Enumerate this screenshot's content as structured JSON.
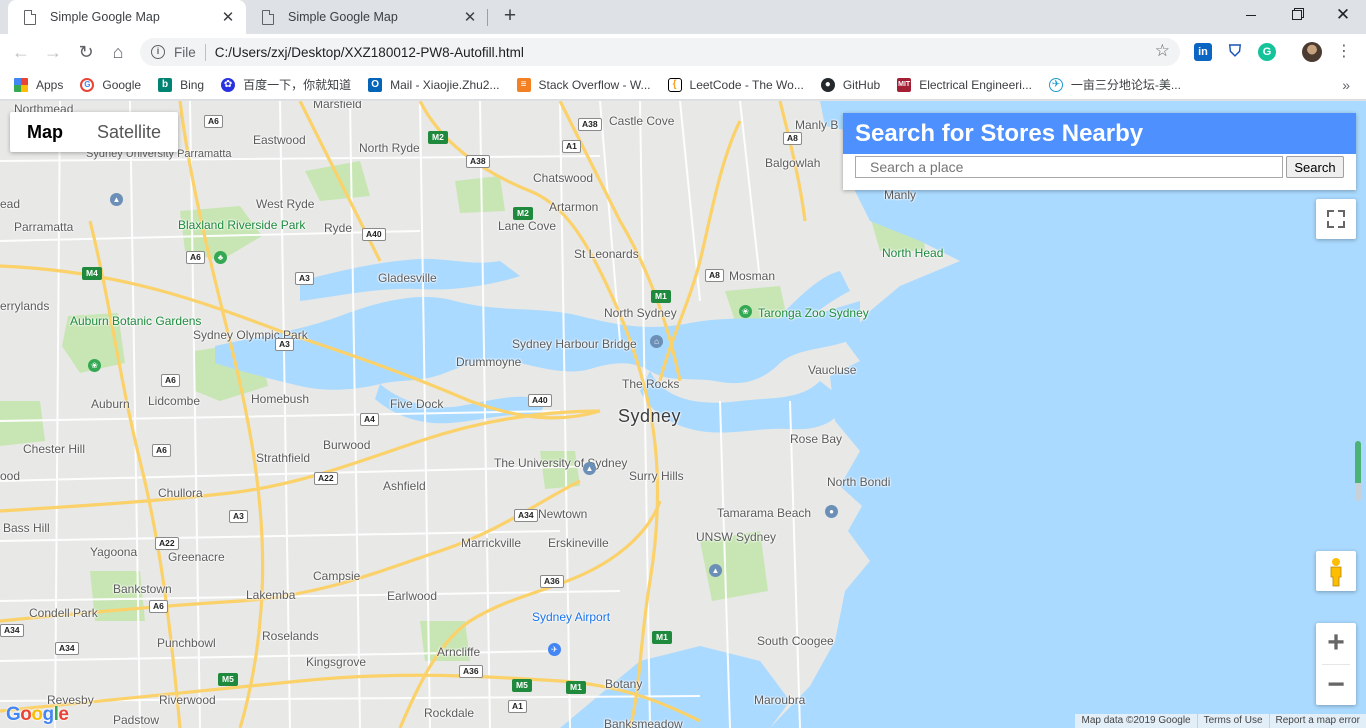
{
  "browser": {
    "tabs": [
      {
        "title": "Simple Google Map",
        "active": true
      },
      {
        "title": "Simple Google Map",
        "active": false
      }
    ],
    "new_tab_icon": "plus-icon",
    "window_controls": [
      "minimize-icon",
      "restore-icon",
      "close-icon"
    ],
    "omnibox": {
      "scheme": "File",
      "url": "C:/Users/zxj/Desktop/XXZ180012-PW8-Autofill.html"
    },
    "bookmarks": [
      {
        "label": "Apps",
        "icon": "apps-icon"
      },
      {
        "label": "Google",
        "icon": "google-icon"
      },
      {
        "label": "Bing",
        "icon": "bing-icon"
      },
      {
        "label": "百度一下，你就知道",
        "icon": "baidu-icon"
      },
      {
        "label": "Mail - Xiaojie.Zhu2...",
        "icon": "outlook-icon"
      },
      {
        "label": "Stack Overflow - W...",
        "icon": "stackoverflow-icon"
      },
      {
        "label": "LeetCode - The Wo...",
        "icon": "leetcode-icon"
      },
      {
        "label": "GitHub",
        "icon": "github-icon"
      },
      {
        "label": "Electrical Engineeri...",
        "icon": "mit-icon"
      },
      {
        "label": "一亩三分地论坛-美...",
        "icon": "yimu-icon"
      }
    ],
    "bookmarks_overflow": "»"
  },
  "map": {
    "type_control": {
      "map": "Map",
      "satellite": "Satellite"
    },
    "search_panel": {
      "title": "Search for Stores Nearby",
      "placeholder": "Search a place",
      "value": "",
      "button": "Search"
    },
    "labels": {
      "sydney": "Sydney",
      "northmead": "Northmead",
      "marsfield": "Marsfield",
      "eastwood": "Eastwood",
      "north_ryde": "North Ryde",
      "castle_cove": "Castle Cove",
      "manly_b": "Manly B",
      "sydney_uni_parramatta": "Sydney University Parramatta",
      "chatswood": "Chatswood",
      "balgowlah": "Balgowlah",
      "manly": "Manly",
      "ead": "ead",
      "parramatta": "Parramatta",
      "blaxland_park": "Blaxland Riverside Park",
      "west_ryde": "West Ryde",
      "ryde": "Ryde",
      "artarmon": "Artarmon",
      "lane_cove": "Lane Cove",
      "north_head": "North Head",
      "st_leonards": "St Leonards",
      "gladesville": "Gladesville",
      "mosman": "Mosman",
      "errylands": "errylands",
      "north_sydney": "North Sydney",
      "taronga": "Taronga Zoo Sydney",
      "auburn_gardens": "Auburn Botanic Gardens",
      "olympic_park": "Sydney Olympic Park",
      "harbour_bridge": "Sydney Harbour Bridge",
      "drummoyne": "Drummoyne",
      "vaucluse": "Vaucluse",
      "the_rocks": "The Rocks",
      "auburn": "Auburn",
      "lidcombe": "Lidcombe",
      "homebush": "Homebush",
      "five_dock": "Five Dock",
      "rose_bay": "Rose Bay",
      "chester_hill": "Chester Hill",
      "burwood": "Burwood",
      "strathfield": "Strathfield",
      "uni_sydney": "The University of Sydney",
      "surry_hills": "Surry Hills",
      "ood": "ood",
      "ashfield": "Ashfield",
      "north_bondi": "North Bondi",
      "chullora": "Chullora",
      "tamarama": "Tamarama Beach",
      "newtown": "Newtown",
      "bass_hill": "Bass Hill",
      "unsw": "UNSW Sydney",
      "yagoona": "Yagoona",
      "greenacre": "Greenacre",
      "marrickville": "Marrickville",
      "erskineville": "Erskineville",
      "campsie": "Campsie",
      "bankstown": "Bankstown",
      "lakemba": "Lakemba",
      "earlwood": "Earlwood",
      "condell_park": "Condell Park",
      "airport": "Sydney Airport",
      "punchbowl": "Punchbowl",
      "roselands": "Roselands",
      "south_coogee": "South Coogee",
      "arncliffe": "Arncliffe",
      "kingsgrove": "Kingsgrove",
      "botany": "Botany",
      "maroubra": "Maroubra",
      "revesby": "Revesby",
      "riverwood": "Riverwood",
      "rockdale": "Rockdale",
      "padstow": "Padstow",
      "banksmeadow": "Banksmeadow"
    },
    "shields": [
      "A6",
      "M2",
      "A38",
      "A1",
      "A8",
      "A38",
      "M2",
      "A40",
      "M4",
      "A6",
      "A3",
      "A8",
      "M1",
      "A3",
      "A6",
      "A4",
      "A40",
      "A6",
      "A22",
      "A34",
      "A3",
      "A22",
      "A36",
      "A6",
      "A34",
      "A34",
      "M1",
      "A36",
      "M5",
      "M5",
      "M1",
      "A1"
    ],
    "footer": {
      "logo": "Google",
      "map_data": "Map data ©2019 Google",
      "terms": "Terms of Use",
      "report": "Report a map error"
    },
    "colors": {
      "water": "#aadaff",
      "land": "#e8e8e6",
      "park": "#c8e6b4",
      "highway": "#fbd16a",
      "panel_header": "#4d90fe"
    }
  }
}
